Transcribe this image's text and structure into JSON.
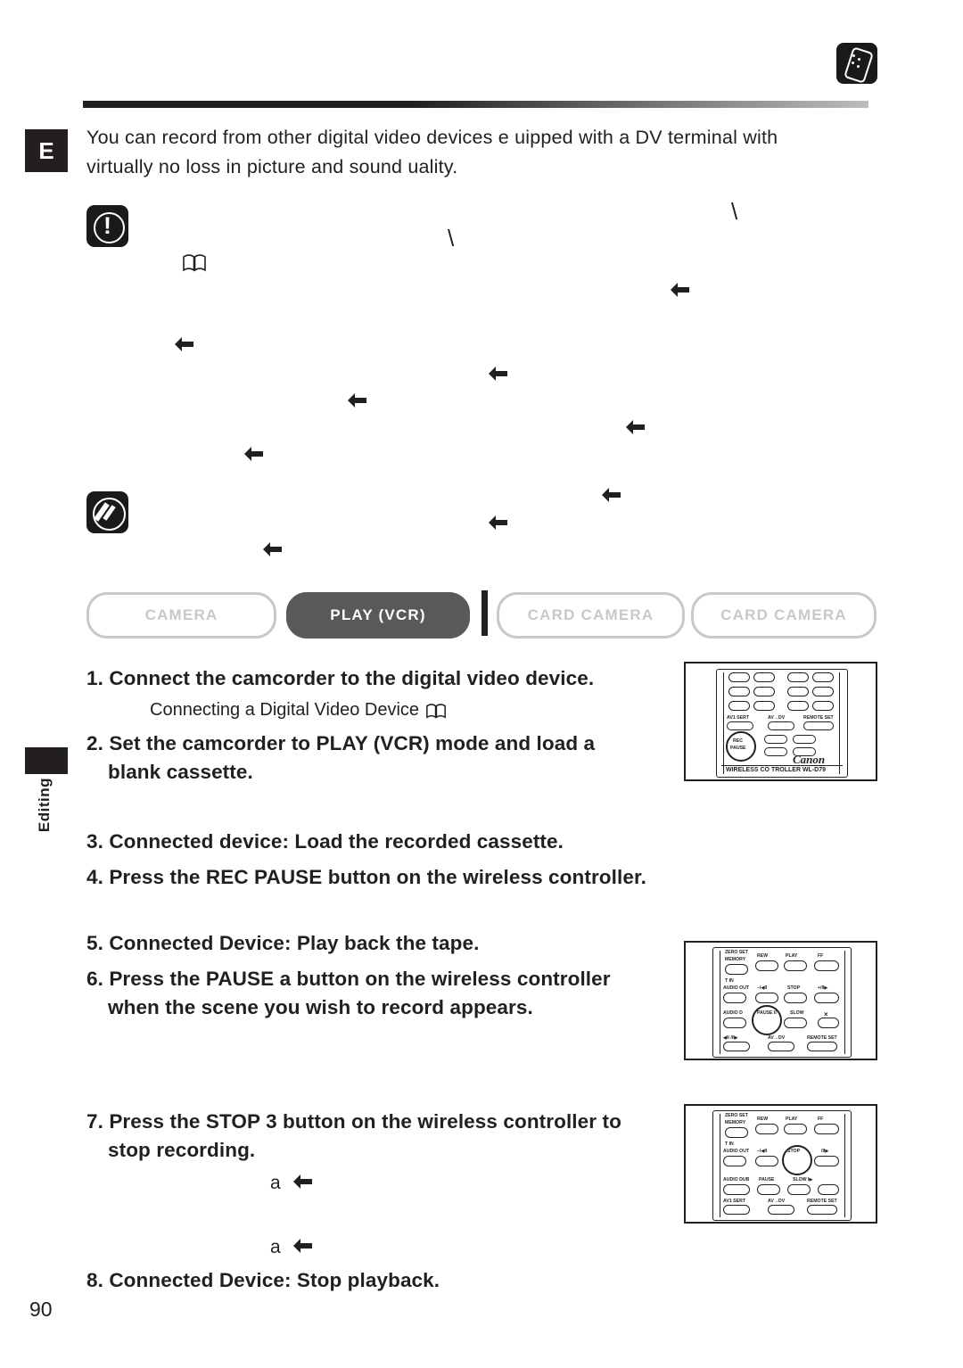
{
  "page": {
    "number": "90",
    "side_tab_label": "Editing",
    "corner_letter": "E"
  },
  "intro": {
    "line1": "You can record from other digital video devices e  uipped with a DV terminal with",
    "line2": "virtually no loss in picture and sound   uality."
  },
  "modebar": {
    "buttons": [
      {
        "label": "CAMERA",
        "state": "off"
      },
      {
        "label": "PLAY (VCR)",
        "state": "on"
      },
      {
        "label": "CARD CAMERA",
        "state": "off"
      },
      {
        "label": "CARD CAMERA",
        "state": "off"
      }
    ]
  },
  "steps": [
    {
      "num": "1.",
      "text": "Connect the camcorder to the digital video device."
    },
    {
      "num": "2.",
      "text": "Set the camcorder to PLAY (VCR) mode and load a",
      "text2": "blank cassette."
    },
    {
      "num": "3.",
      "text": "Connected device: Load the recorded cassette."
    },
    {
      "num": "4.",
      "text": "Press the REC PAUSE button on the wireless controller."
    },
    {
      "num": "5.",
      "text": "Connected Device: Play back the tape."
    },
    {
      "num": "6.",
      "text": "Press the PAUSE a  button on the wireless controller",
      "text2": "when the scene you wish to record appears."
    },
    {
      "num": "7.",
      "text": "Press the STOP 3  button on the wireless controller to",
      "text2": "stop recording."
    },
    {
      "num": "8.",
      "text": "Connected Device: Stop playback."
    }
  ],
  "substep": {
    "text": "Connecting a Digital Video Device"
  },
  "inline_markers": {
    "a1": "a",
    "a2": "a"
  },
  "remote_top": {
    "top_labels": [
      "AV1 SERT",
      "AV→DV",
      "REMOTE SET"
    ],
    "button_label_line1": "REC",
    "button_label_line2": "PAUSE",
    "brand": "Canon",
    "model_text": "WIRELESS CO   TROLLER WL-D79"
  },
  "remote_mid": {
    "labels_row1": [
      "ZERO SET",
      "MEMORY",
      "REW",
      "PLAY",
      "FF"
    ],
    "labels_row2": [
      "T  IN",
      "AUDIO OUT",
      "–/◀II",
      "STOP",
      "+/II▶"
    ],
    "labels_row3": [
      "AUDIO D",
      "PAUSE II",
      "SLOW",
      "×"
    ],
    "labels_row4": [
      "◀II /II▶",
      "AV→DV",
      "REMOTE SET"
    ]
  },
  "remote_bottom": {
    "labels_row1": [
      "ZERO SET",
      "MEMORY",
      "REW",
      "PLAY",
      "FF"
    ],
    "labels_row2": [
      "T  IN",
      "AUDIO OUT",
      "–/◀II",
      "STOP",
      "/II▶"
    ],
    "labels_row3": [
      "AUDIO DUB",
      "PAUSE",
      "SLOW I▶"
    ],
    "labels_row4": [
      "AV1 SERT",
      "AV→DV",
      "REMOTE SET"
    ]
  },
  "colors": {
    "ink": "#231f20",
    "muted": "#c7c8ca",
    "active_pill": "#58595b"
  }
}
